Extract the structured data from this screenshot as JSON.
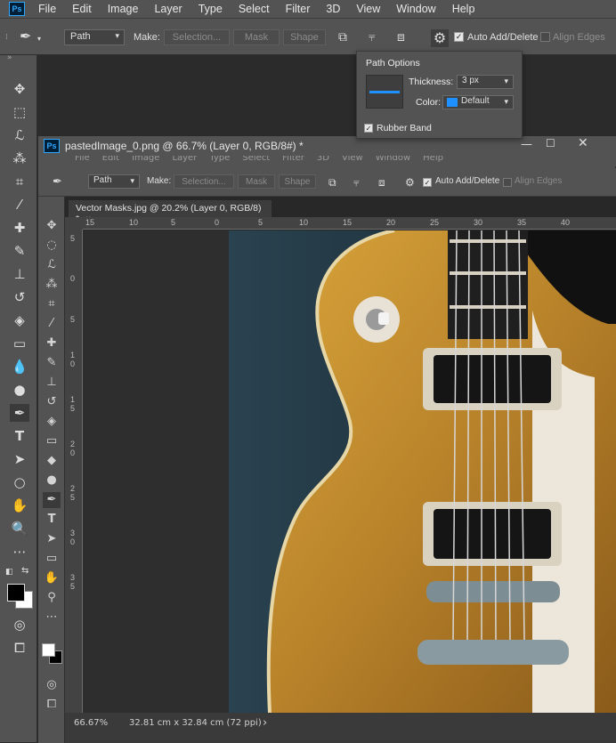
{
  "menubar": {
    "app_logo": "Ps",
    "items": [
      "File",
      "Edit",
      "Image",
      "Layer",
      "Type",
      "Select",
      "Filter",
      "3D",
      "View",
      "Window",
      "Help"
    ]
  },
  "options_bar": {
    "mode_value": "Path",
    "make_label": "Make:",
    "selection_label": "Selection...",
    "mask_label": "Mask",
    "shape_label": "Shape",
    "auto_add_delete_label": "Auto Add/Delete",
    "auto_add_delete_checked": true,
    "align_edges_label": "Align Edges",
    "align_edges_checked": false
  },
  "path_options": {
    "title": "Path Options",
    "thickness_label": "Thickness:",
    "thickness_value": "3 px",
    "color_label": "Color:",
    "color_value": "Default",
    "color_swatch": "#1e90ff",
    "rubber_band_label": "Rubber Band",
    "rubber_band_checked": true
  },
  "inner_window": {
    "title": "pastedImage_0.png @ 66.7% (Layer 0, RGB/8#) *",
    "app_logo": "Ps",
    "menu_items": [
      "File",
      "Edit",
      "Image",
      "Layer",
      "Type",
      "Select",
      "Filter",
      "3D",
      "View",
      "Window",
      "Help"
    ],
    "options": {
      "mode_value": "Path",
      "make_label": "Make:",
      "selection_label": "Selection...",
      "mask_label": "Mask",
      "shape_label": "Shape",
      "auto_add_delete_label": "Auto Add/Delete",
      "align_edges_label": "Align Edges"
    },
    "doc_tab": {
      "label": "Vector Masks.jpg @ 20.2% (Layer 0, RGB/8) *",
      "close": "×"
    },
    "ruler_h_labels": [
      "15",
      "10",
      "5",
      "0",
      "5",
      "10",
      "15",
      "20",
      "25",
      "30",
      "35",
      "40"
    ],
    "ruler_v_labels": [
      "5",
      "0",
      "5",
      "1",
      "0",
      "1",
      "5",
      "2",
      "0",
      "2",
      "5",
      "3",
      "0",
      "3",
      "5"
    ],
    "status": {
      "zoom": "66.67%",
      "doc_info": "32.81 cm x 32.84 cm (72 ppi)",
      "arrow": "›"
    }
  },
  "colors": {
    "accent": "#31a8ff",
    "panel_bg": "#535353",
    "foreground_swatch": "#000000",
    "background_swatch": "#ffffff"
  }
}
